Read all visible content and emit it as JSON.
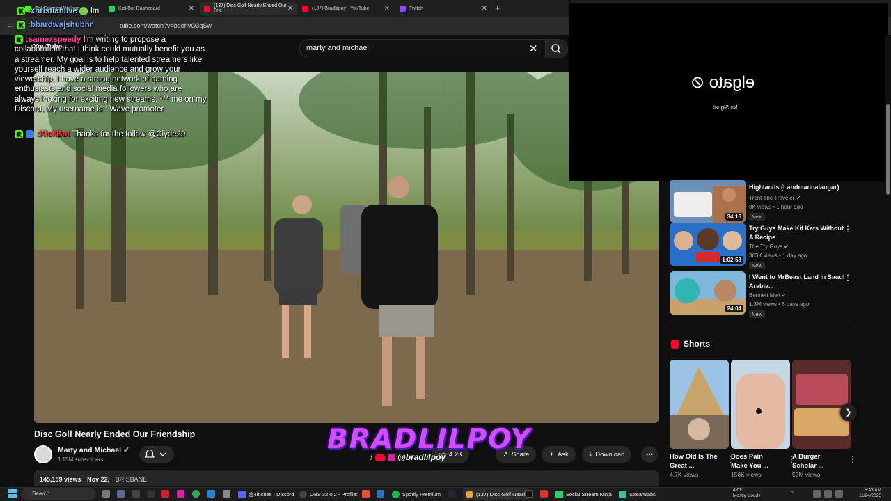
{
  "browser": {
    "tabs": [
      {
        "label": "Bot Erswmsl Weltum",
        "favicon_color": "#53fc18"
      },
      {
        "label": "KickBot Dashboard",
        "favicon_color": "#2ecc71"
      },
      {
        "label": "(137) Disc Golf Nearly Ended Our Frie",
        "favicon_color": "#ff0033",
        "active": true
      },
      {
        "label": "(137) Bradlilpoy - YouTube",
        "favicon_color": "#ff0033"
      },
      {
        "label": "Twitch",
        "favicon_color": "#9146ff"
      }
    ],
    "new_tab": "+",
    "url": "tube.com/watch?v=bperlvO3qSw"
  },
  "youtube": {
    "logo_text": "YouTube",
    "search_value": "marty and michael",
    "video": {
      "title": "Disc Golf Nearly Ended Our Friendship",
      "channel": "Marty and Michael",
      "subscribers": "1.15M subscribers",
      "views": "145,159 views",
      "date": "Nov 22,",
      "location": "BRISBANE",
      "actions": {
        "likes": "4.2K",
        "share": "Share",
        "ask": "Ask",
        "download": "Download"
      }
    },
    "recommendations": [
      {
        "title": "Highlands (Landmannalaugar)",
        "channel": "Trent The Traveler",
        "views": "8K views • 1 hour ago",
        "duration": "34:16",
        "badge": "New"
      },
      {
        "title": "Try Guys Make Kit Kats Without A Recipe",
        "channel": "The Try Guys",
        "views": "363K views • 1 day ago",
        "duration": "1:02:58",
        "badge": "New"
      },
      {
        "title": "I Went to MrBeast Land in Saudi Arabia...",
        "channel": "Bennett Melt",
        "views": "1.3M views • 6 days ago",
        "duration": "24:04",
        "badge": "New"
      }
    ],
    "shorts": {
      "title": "Shorts",
      "items": [
        {
          "title": "How Old Is The Great ...",
          "views": "4.7K views"
        },
        {
          "title": "Does Pain Make You ...",
          "views": "156K views"
        },
        {
          "title": "A Burger Scholar ...",
          "views": "53M views"
        }
      ]
    }
  },
  "overlay": {
    "brand": "BRADLILPOY",
    "handle": "@bradlilpoy",
    "elgato": {
      "logo": "elgato",
      "status": "No Signal"
    },
    "chat": [
      {
        "user": ":xhristianlive",
        "msg": "lm",
        "color": "#7fd4ff"
      },
      {
        "user": ":bbardwajshubhr",
        "msg": "",
        "color": "#6ea8ff"
      },
      {
        "user": ":samexspeedy",
        "msg": "I'm writing to propose a collaboration that I think could mutually benefit you as a streamer. My goal is to help talented streamers like yourself reach a wider audience and grow your viewership. I have a strong network of gaming enthusiasts and social media followers who are always looking for exciting new streams. *** me on my Discord, My username is : Wave promoter",
        "color": "#ff3a9d"
      },
      {
        "user": ":KickBot",
        "msg": "Thanks for the follow @Clyde29",
        "color": "#ff2d2d"
      }
    ]
  },
  "taskbar": {
    "search": "Search",
    "apps": [
      {
        "label": "@4inches - Discord",
        "color": "#5865f2"
      },
      {
        "label": "OBS 32.0.2 - Profile:",
        "color": "#444"
      },
      {
        "label": "Spotify Premium",
        "color": "#1db954"
      },
      {
        "label": "(137) Disc Golf Nearl",
        "color": "#e8a33d"
      },
      {
        "label": "Social Stream Ninja",
        "color": "#2ecc71"
      },
      {
        "label": "Streamlabs",
        "color": "#31c3a2"
      }
    ],
    "weather_temp": "48°F",
    "weather_desc": "Mostly cloudy",
    "time": "6:43 AM",
    "date": "11/24/2025"
  }
}
